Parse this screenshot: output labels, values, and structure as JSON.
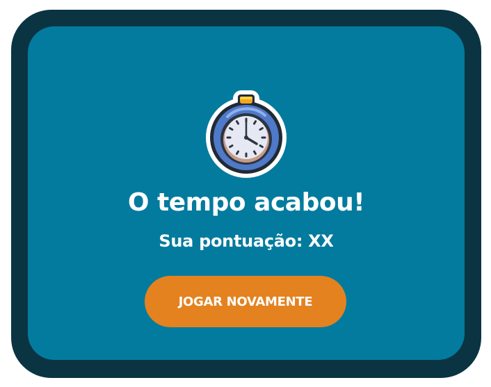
{
  "dialog": {
    "title": "O tempo acabou!",
    "score_text": "Sua pontuação: XX",
    "play_again_label": "JOGAR NOVAMENTE"
  },
  "icon": {
    "name": "stopwatch-icon"
  },
  "colors": {
    "frame": "#0b3443",
    "panel": "#037b9e",
    "button": "#e4821f",
    "text": "#ffffff"
  }
}
